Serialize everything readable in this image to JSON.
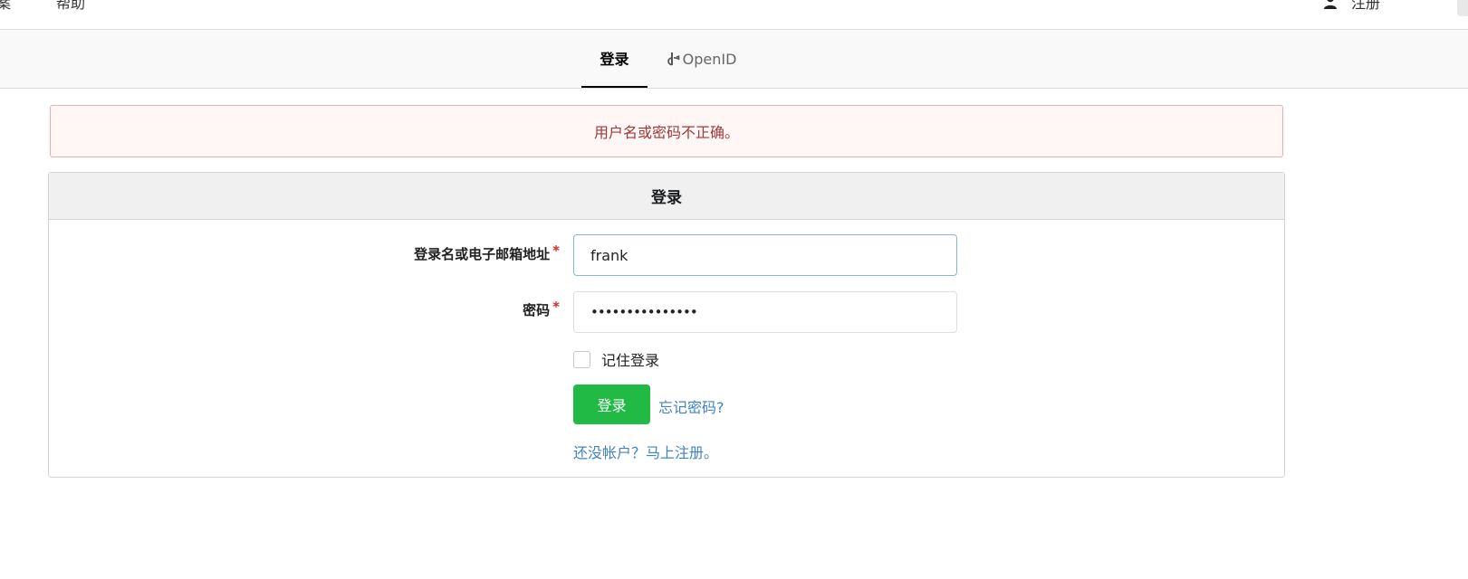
{
  "topnav": {
    "item_partial_left": "案",
    "help": "帮助",
    "register": "注册",
    "user_icon": "user-icon"
  },
  "tabs": [
    {
      "label": "登录",
      "active": true
    },
    {
      "label": "OpenID",
      "icon": "openid-icon"
    }
  ],
  "alert": {
    "message": "用户名或密码不正确。"
  },
  "form": {
    "title": "登录",
    "username": {
      "label": "登录名或电子邮箱地址",
      "required_mark": "*",
      "value": "frank"
    },
    "password": {
      "label": "密码",
      "required_mark": "*",
      "value": "•••••••••••••••"
    },
    "remember_label": "记住登录",
    "submit_label": "登录",
    "forgot_link": "忘记密码?",
    "register_link": "还没帐户？马上注册。"
  },
  "colors": {
    "primary_button": "#21ba45",
    "link": "#4183c4",
    "error_text": "#9f3a38",
    "error_bg": "#fff6f6"
  }
}
